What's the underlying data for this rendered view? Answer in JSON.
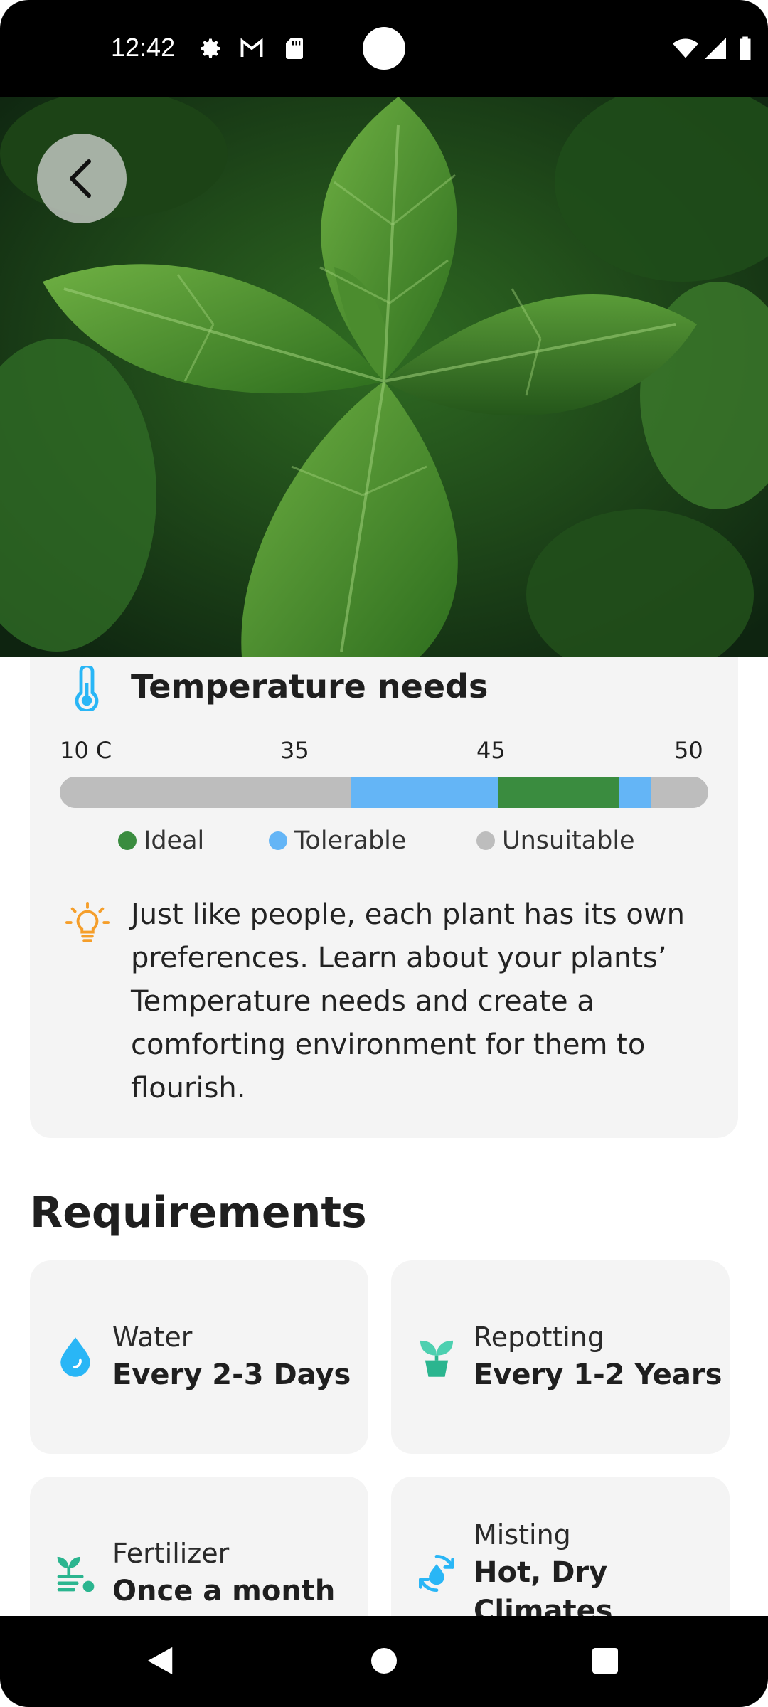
{
  "status_bar": {
    "time": "12:42",
    "icons": [
      "gear-icon",
      "gmail-icon",
      "sd-card-icon",
      "wifi-icon",
      "signal-icon",
      "battery-icon"
    ]
  },
  "hero": {
    "back_icon": "chevron-left-icon"
  },
  "temperature": {
    "title": "Temperature needs",
    "ticks": [
      "10 C",
      "35",
      "45",
      "50"
    ],
    "range": {
      "min": 10,
      "max": 50
    },
    "segments": [
      {
        "status": "unsuitable",
        "from": 10,
        "to": 28
      },
      {
        "status": "tolerable",
        "from": 28,
        "to": 37
      },
      {
        "status": "ideal",
        "from": 37,
        "to": 44.5
      },
      {
        "status": "tolerable",
        "from": 44.5,
        "to": 46.5
      },
      {
        "status": "unsuitable",
        "from": 46.5,
        "to": 50
      }
    ],
    "legend": [
      {
        "label": "Ideal",
        "color": "#3a8c3f"
      },
      {
        "label": "Tolerable",
        "color": "#64b5f6"
      },
      {
        "label": "Unsuitable",
        "color": "#bdbdbd"
      }
    ],
    "tip": "Just like people, each plant has its own preferences. Learn about your plants’ Temperature needs and create a comforting environment for them to flourish."
  },
  "requirements": {
    "heading": "Requirements",
    "items": [
      {
        "label": "Water",
        "value": "Every 2-3 Days",
        "icon": "water-drop-icon"
      },
      {
        "label": "Repotting",
        "value": "Every 1-2 Years",
        "icon": "plant-pot-icon"
      },
      {
        "label": "Fertilizer",
        "value": "Once a month",
        "icon": "fertilizer-icon"
      },
      {
        "label": "Misting",
        "value": "Hot, Dry Climates",
        "icon": "misting-icon"
      }
    ]
  },
  "colors": {
    "ideal": "#3a8c3f",
    "tolerable": "#64b5f6",
    "unsuitable": "#bdbdbd",
    "card_bg": "#f4f4f4"
  }
}
